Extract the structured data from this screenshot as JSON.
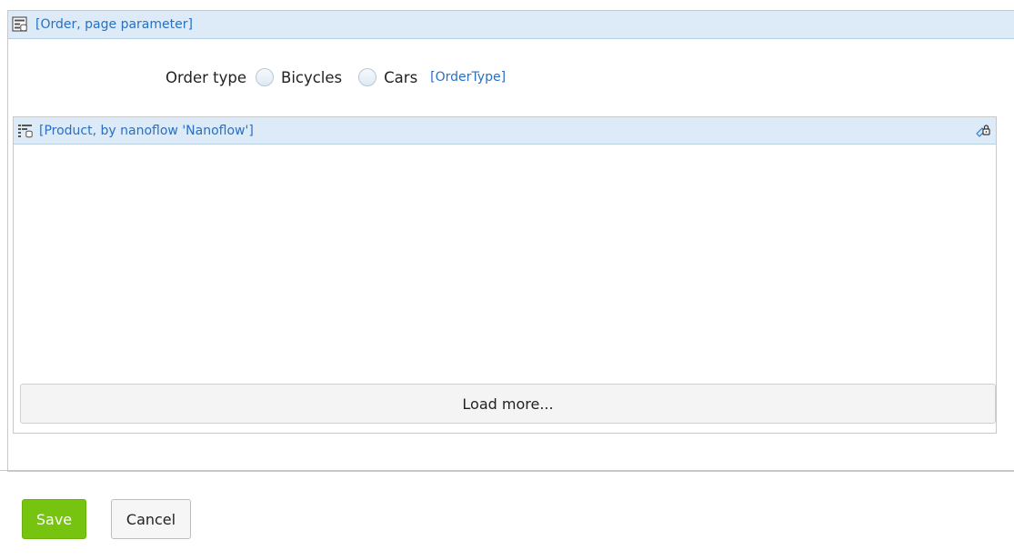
{
  "dataview": {
    "header_label": "[Order, page parameter]",
    "icon": "dataview-icon"
  },
  "order_type": {
    "label": "Order type",
    "options": [
      "Bicycles",
      "Cars"
    ],
    "selected": null,
    "attribute_label": "[OrderType]"
  },
  "listview": {
    "header_label": "[Product, by nanoflow 'Nanoflow']",
    "icon": "listview-icon",
    "security_icon": "lock-icon",
    "load_more_label": "Load more..."
  },
  "footer": {
    "save_label": "Save",
    "cancel_label": "Cancel"
  },
  "colors": {
    "header_bg": "#dcebf7",
    "link_blue": "#2a6fc2",
    "save_green": "#76c310"
  }
}
